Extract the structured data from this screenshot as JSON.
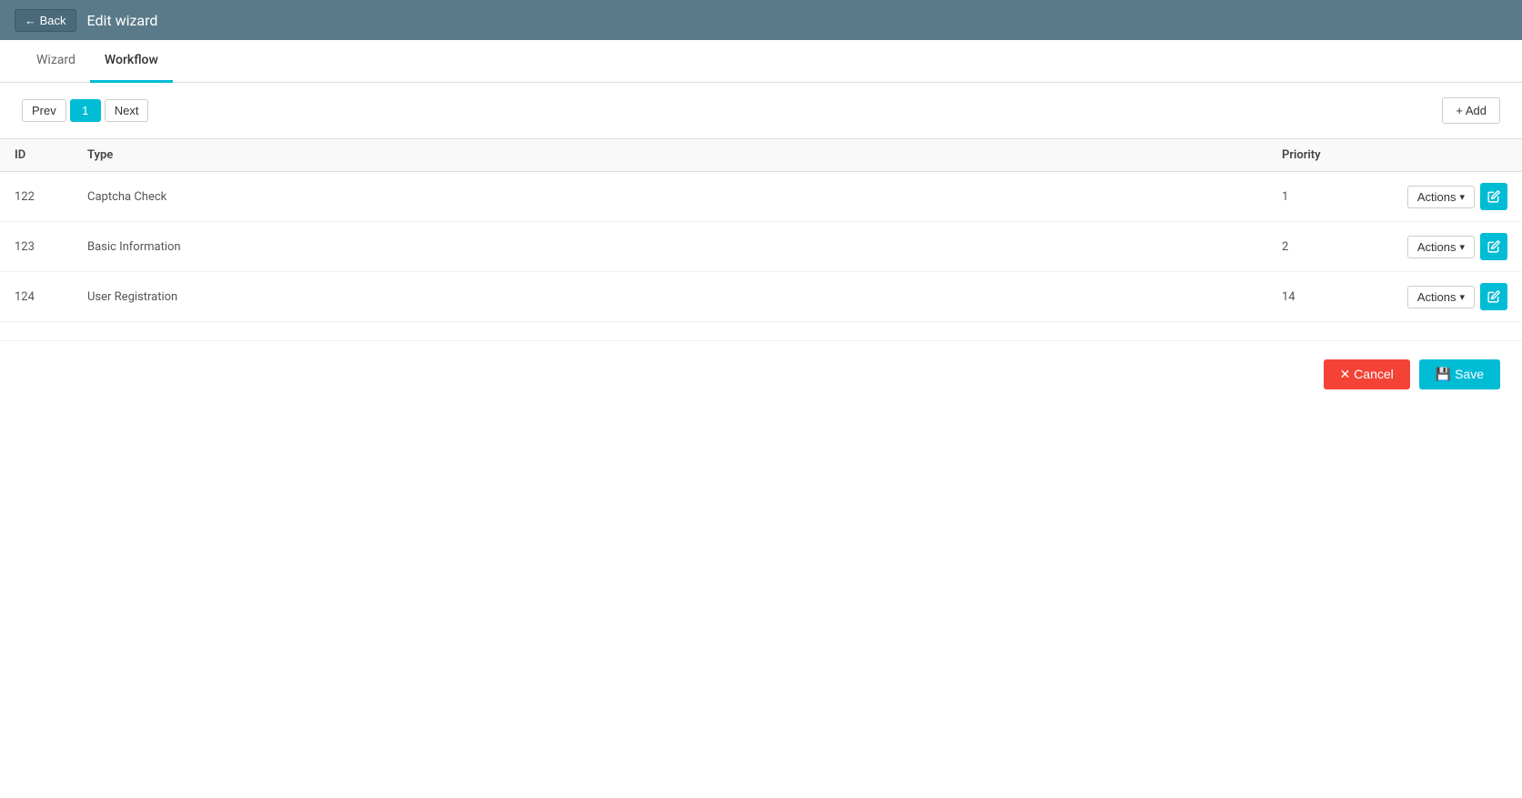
{
  "header": {
    "back_label": "← Back",
    "title": "Edit wizard"
  },
  "tabs": [
    {
      "id": "wizard",
      "label": "Wizard",
      "active": false
    },
    {
      "id": "workflow",
      "label": "Workflow",
      "active": true
    }
  ],
  "pagination": {
    "prev_label": "Prev",
    "current_page": "1",
    "next_label": "Next"
  },
  "add_button_label": "+ Add",
  "table": {
    "columns": {
      "id": "ID",
      "type": "Type",
      "priority": "Priority"
    },
    "rows": [
      {
        "id": "122",
        "type": "Captcha Check",
        "priority": "1"
      },
      {
        "id": "123",
        "type": "Basic Information",
        "priority": "2"
      },
      {
        "id": "124",
        "type": "User Registration",
        "priority": "14"
      }
    ],
    "actions_label": "Actions",
    "edit_icon": "✎"
  },
  "footer": {
    "cancel_label": "✕ Cancel",
    "save_label": "💾 Save"
  },
  "colors": {
    "accent": "#00bcd4",
    "header_bg": "#5a7a8a",
    "cancel_bg": "#f44336"
  }
}
